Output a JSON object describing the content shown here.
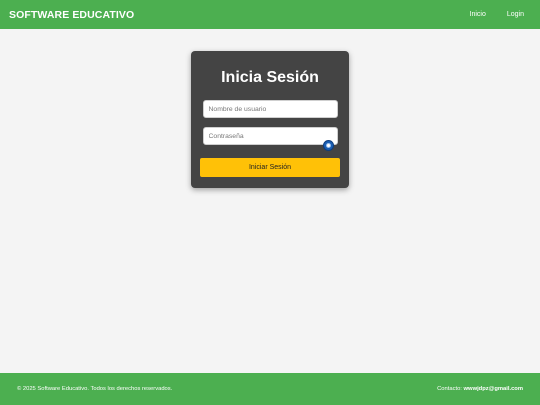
{
  "header": {
    "brand": "SOFTWARE EDUCATIVO",
    "nav": [
      {
        "label": "Inicio"
      },
      {
        "label": "Login"
      }
    ]
  },
  "login": {
    "title": "Inicia Sesión",
    "username": {
      "placeholder": "Nombre de usuario",
      "value": ""
    },
    "password": {
      "placeholder": "Contraseña",
      "value": ""
    },
    "submit_label": "Iniciar Sesión",
    "toggle_icon": "eye-icon"
  },
  "footer": {
    "copyright": "© 2025 Software Educativo. Todos los derechos reservados.",
    "contact_label": "Contacto:",
    "contact_email": "wwwjdpz@gmail.com"
  },
  "colors": {
    "primary": "#4caf50",
    "card": "#444444",
    "button": "#ffc107",
    "background": "#f4f4f4",
    "toggle": "#1a5fb4"
  }
}
